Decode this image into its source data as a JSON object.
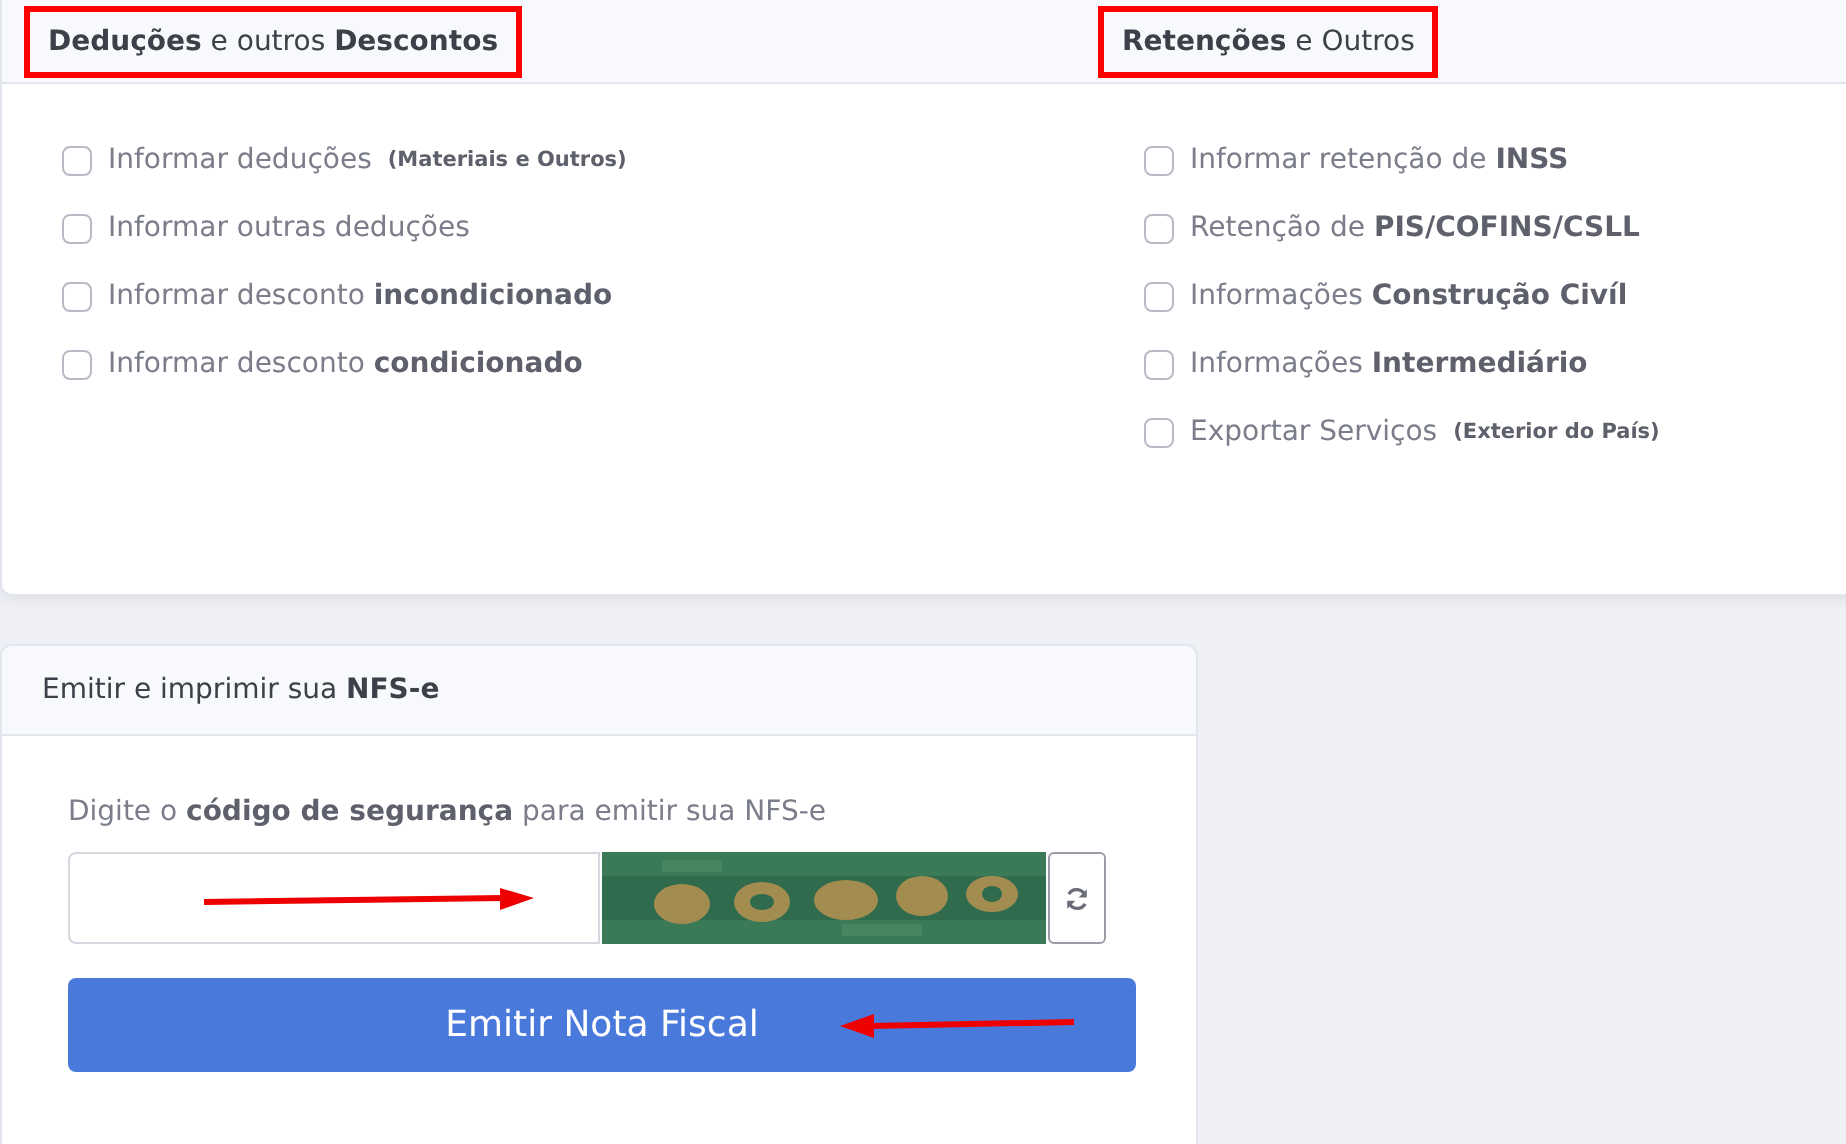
{
  "sections": [
    {
      "title": "**Deduções** e outros **Descontos**",
      "highlighted": true,
      "options": [
        {
          "label": "Informar deduções",
          "note": "(Materiais e Outros)",
          "checked": false
        },
        {
          "label": "Informar outras deduções",
          "checked": false
        },
        {
          "label": "Informar desconto **incondicionado**",
          "checked": false
        },
        {
          "label": "Informar desconto **condicionado**",
          "checked": false
        }
      ]
    },
    {
      "title": "**Retenções** e Outros",
      "highlighted": true,
      "options": [
        {
          "label": "Informar retenção de **INSS**",
          "checked": false
        },
        {
          "label": "Retenção de **PIS/COFINS/CSLL**",
          "checked": false
        },
        {
          "label": "Informações **Construção Civíl**",
          "checked": false
        },
        {
          "label": "Informações **Intermediário**",
          "checked": false
        },
        {
          "label": "Exportar Serviços",
          "note": "(Exterior do País)",
          "checked": false
        }
      ]
    }
  ],
  "emit": {
    "title": "Emitir e imprimir sua **NFS-e**",
    "prompt": "Digite o **código de segurança** para emitir sua NFS-e",
    "button": "Emitir Nota Fiscal"
  }
}
